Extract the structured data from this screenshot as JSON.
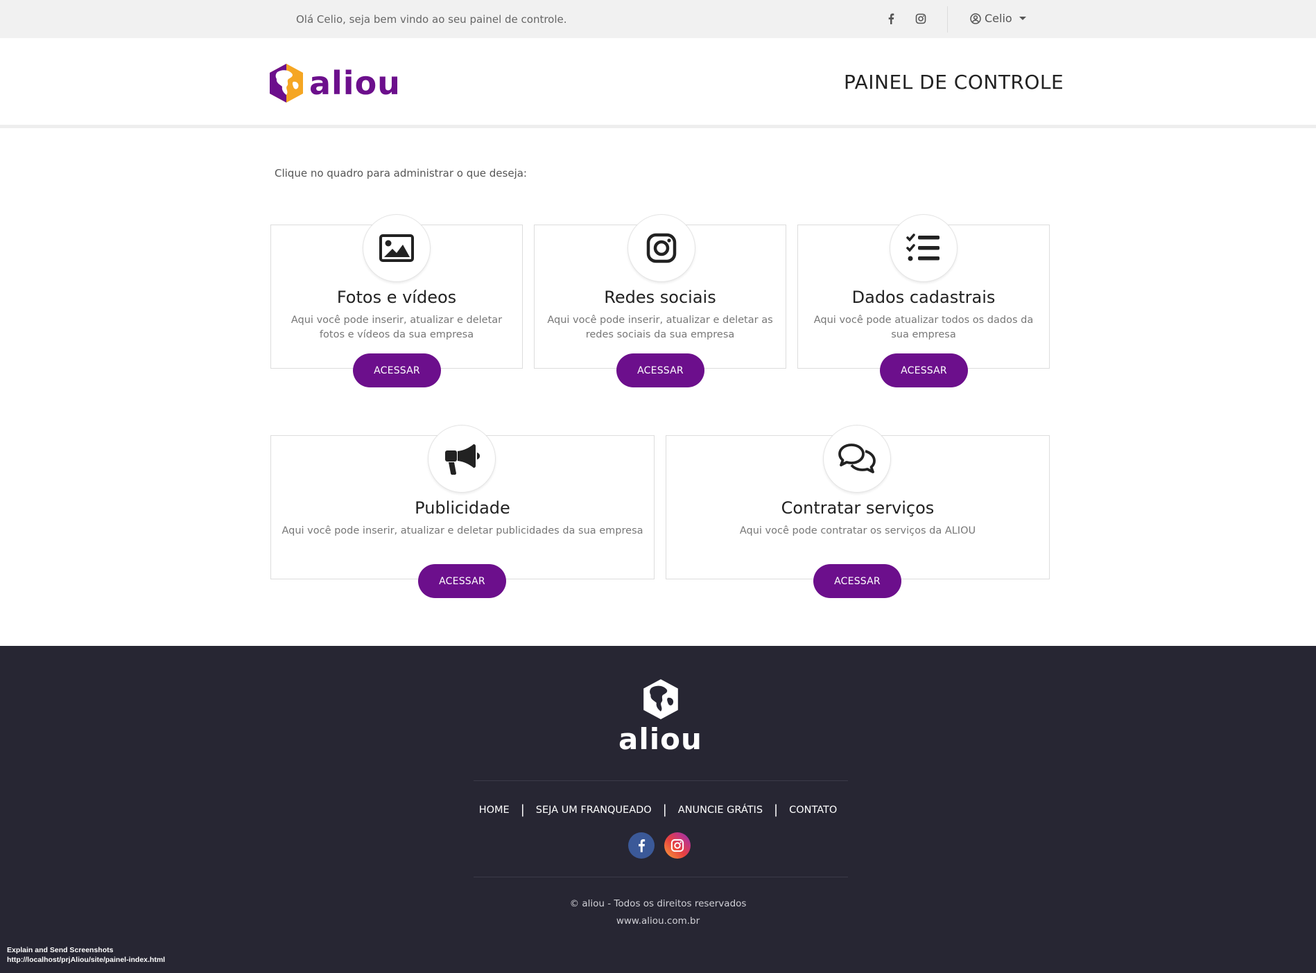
{
  "topbar": {
    "greeting": "Olá Celio, seja bem vindo ao seu painel de controle.",
    "facebook_icon": "facebook-icon",
    "instagram_icon": "instagram-icon",
    "user_icon": "user-circle-icon",
    "user_name": "Celio"
  },
  "header": {
    "logo_text": "aliou",
    "page_title": "PAINEL DE CONTROLE"
  },
  "main": {
    "instruction": "Clique no quadro para administrar o que deseja:",
    "cards": [
      {
        "icon": "image-icon",
        "title": "Fotos e vídeos",
        "description": "Aqui você pode inserir, atualizar e deletar fotos e vídeos da sua empresa",
        "button": "ACESSAR"
      },
      {
        "icon": "instagram-icon",
        "title": "Redes sociais",
        "description": "Aqui você pode inserir, atualizar e deletar as redes sociais da sua empresa",
        "button": "ACESSAR"
      },
      {
        "icon": "checklist-icon",
        "title": "Dados cadastrais",
        "description": "Aqui você pode atualizar todos os dados da sua empresa",
        "button": "ACESSAR"
      },
      {
        "icon": "megaphone-icon",
        "title": "Publicidade",
        "description": "Aqui você pode inserir, atualizar e deletar publicidades da sua empresa",
        "button": "ACESSAR"
      },
      {
        "icon": "chat-bubbles-icon",
        "title": "Contratar serviços",
        "description": "Aqui você pode contratar os serviços da ALIOU",
        "button": "ACESSAR"
      }
    ]
  },
  "footer": {
    "logo_text": "aliou",
    "nav": [
      "HOME",
      "SEJA UM FRANQUEADO",
      "ANUNCIE GRÁTIS",
      "CONTATO"
    ],
    "nav_separator": "|",
    "social": [
      "facebook-icon",
      "instagram-icon"
    ],
    "copyright": "© aliou - Todos os direitos reservados",
    "website": "www.aliou.com.br"
  },
  "overlay": {
    "line1": "Explain and Send Screenshots",
    "line2": "http://localhost/prjAliou/site/painel-index.html"
  },
  "colors": {
    "brand_purple": "#6c0f8c",
    "brand_orange": "#f5a623",
    "footer_bg": "#272633",
    "topbar_bg": "#f1f1f1"
  }
}
